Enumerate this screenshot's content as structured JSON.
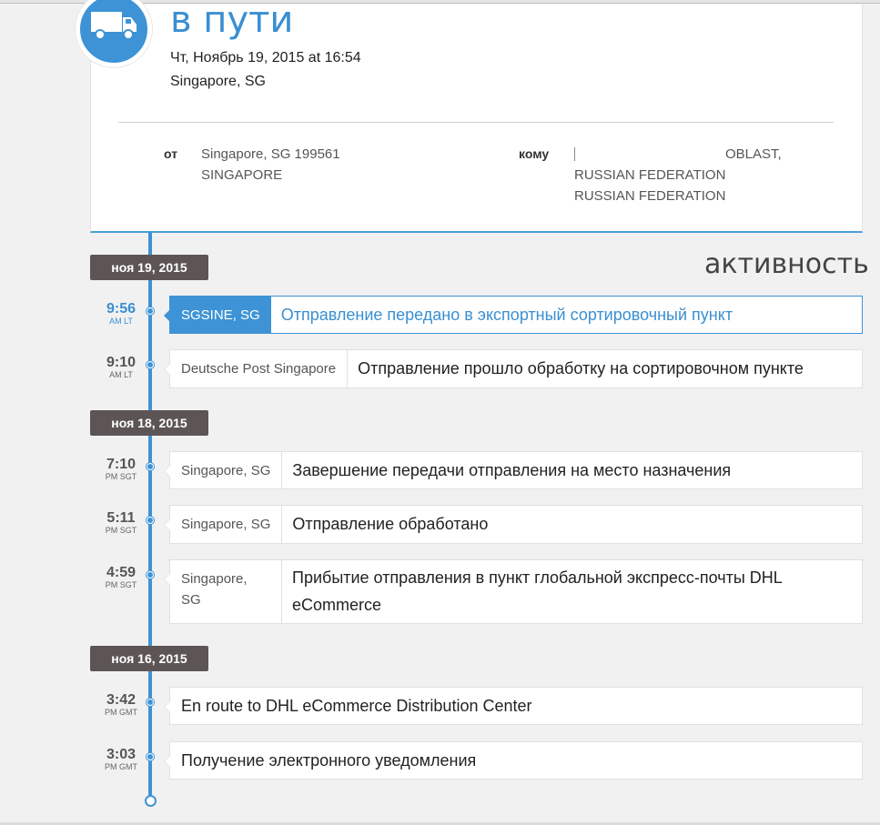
{
  "status": {
    "title": "в пути",
    "date": "Чт, Ноябрь 19, 2015 at 16:54",
    "location": "Singapore, SG"
  },
  "from": {
    "label": "от",
    "lines": [
      "Singapore, SG 199561",
      "SINGAPORE"
    ]
  },
  "to": {
    "label": "кому",
    "lines": [
      "OBLAST,",
      "RUSSIAN FEDERATION",
      "RUSSIAN FEDERATION"
    ]
  },
  "activity_title": "активность",
  "groups": [
    {
      "date": "ноя 19, 2015"
    },
    {
      "date": "ноя 18, 2015"
    },
    {
      "date": "ноя 16, 2015"
    }
  ],
  "events": [
    {
      "time": "9:56",
      "zone": "AM LT",
      "location": "SGSINE, SG",
      "description": "Отправление передано в экспортный сортировочный пункт"
    },
    {
      "time": "9:10",
      "zone": "AM LT",
      "location": "Deutsche Post Singapore",
      "description": "Отправление прошло обработку на сортировочном пункте"
    },
    {
      "time": "7:10",
      "zone": "PM SGT",
      "location": "Singapore, SG",
      "description": "Завершение передачи отправления на место назначения"
    },
    {
      "time": "5:11",
      "zone": "PM SGT",
      "location": "Singapore, SG",
      "description": "Отправление обработано"
    },
    {
      "time": "4:59",
      "zone": "PM SGT",
      "location": "Singapore, SG",
      "description": "Прибытие отправления в пункт глобальной экспресс-почты DHL eCommerce"
    },
    {
      "time": "3:42",
      "zone": "PM GMT",
      "location": "",
      "description": "En route to DHL eCommerce Distribution Center"
    },
    {
      "time": "3:03",
      "zone": "PM GMT",
      "location": "",
      "description": "Получение электронного уведомления"
    }
  ],
  "colors": {
    "accent": "#3d93d6",
    "badge": "#5d5555"
  },
  "icons": {
    "status": "truck-icon"
  }
}
